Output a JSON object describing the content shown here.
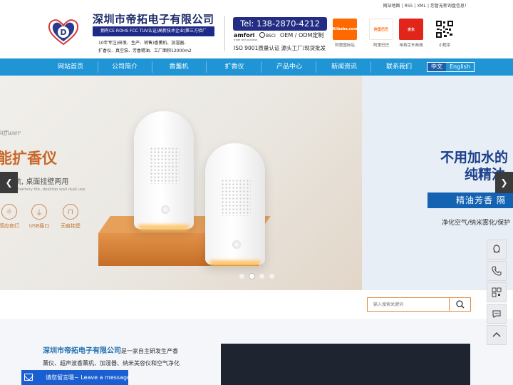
{
  "top_links": {
    "sitemap": "网站地图",
    "rss": "RSS",
    "xml": "XML",
    "inquiry": "您暂无新询盘信息！"
  },
  "header": {
    "company_name": "深圳市帝拓电子有限公司",
    "cert_badge": "拥有CE ROHS FCC TUV认证/高新技术企业/第三方验厂",
    "intro_line1": "10年专注(研发、生产、销售)香薰机、加湿器、",
    "intro_line2": "扩香仪、真空泵、芳香精油、工厂面积12000m2",
    "logo_letter": "D",
    "tel": "Tel: 138-2870-4212",
    "amfori": "amfori",
    "amfori_sub": "trade with purpose",
    "bsci": "BSCI",
    "oem": "OEM / ODM定制",
    "iso": "ISO 9001质量认证  源头工厂/现货批发"
  },
  "stores": [
    {
      "name": "阿里国际站",
      "icon": "alibaba-icon",
      "text": "Alibaba.com"
    },
    {
      "name": "阿里巴巴",
      "icon": "1688-icon",
      "text": "阿里巴巴"
    },
    {
      "name": "帝拓京东商城",
      "icon": "jd-icon",
      "text": "京东"
    },
    {
      "name": "小程序",
      "icon": "qrcode-icon",
      "text": ""
    }
  ],
  "nav": {
    "items": [
      "网站首页",
      "公司简介",
      "香薰机",
      "扩香仪",
      "产品中心",
      "新闻资讯",
      "联系我们"
    ],
    "lang_cn": "中文",
    "lang_en": "English"
  },
  "banner": {
    "script_text": "Diffuser",
    "title": "能扩香仪",
    "line1": "电续航, 桌面挂壁两用",
    "line2": "charging battery life, desktop wall dual use",
    "features": [
      {
        "label": "感应夜灯",
        "icon": "sun-icon"
      },
      {
        "label": "USB插口",
        "icon": "usb-icon"
      },
      {
        "label": "无痕挂壁",
        "icon": "wall-hook-icon"
      }
    ],
    "right_title1": "不用加水的",
    "right_title2": "纯精油",
    "right_bar": "精油芳香  隔",
    "right_text": "净化空气/纳米雾化/保护",
    "slide_count": 4,
    "active_slide": 1
  },
  "search": {
    "placeholder": "输入搜索关键词"
  },
  "about": {
    "company": "深圳市帝拓电子有限公司",
    "rest": "是一家自主研发生产香薰仪、超声波香薰机、加湿器、纳米美容仪和空气净化器等产品，产品主要用于酒店、"
  },
  "float_buttons": [
    "qq-icon",
    "phone-icon",
    "qrcode-icon",
    "wechat-icon",
    "back-to-top-icon"
  ],
  "leave_message": "请您留言哦~ Leave a message",
  "colors": {
    "nav": "#1f95d6",
    "brand_dark": "#232d83",
    "accent_orange": "#e08a3a"
  }
}
